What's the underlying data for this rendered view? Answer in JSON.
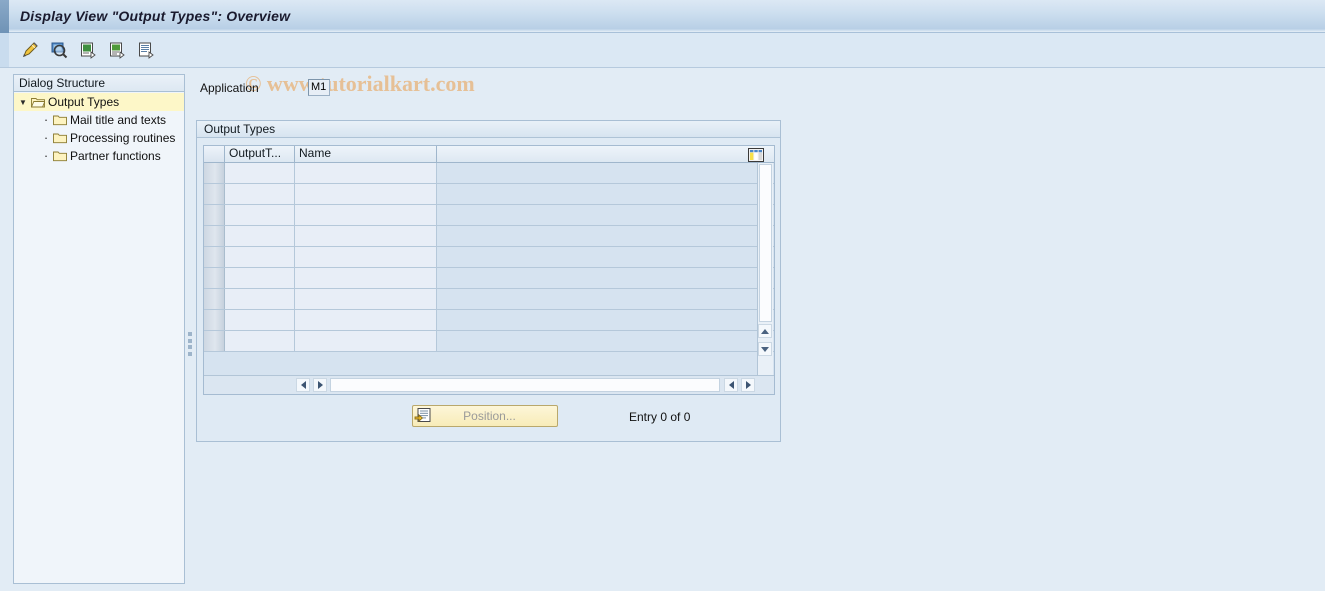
{
  "window": {
    "title": "Display View \"Output Types\": Overview"
  },
  "toolbar": {
    "buttons": [
      {
        "name": "display-change-icon",
        "title": "Display <-> Change"
      },
      {
        "name": "check-icon",
        "title": "Check"
      },
      {
        "name": "new-entries-icon",
        "title": "New Entries"
      },
      {
        "name": "copy-as-icon",
        "title": "Copy As..."
      },
      {
        "name": "details-icon",
        "title": "Details"
      }
    ]
  },
  "watermark": {
    "text": "© www.tutorialkart.com",
    "color": "#e7b986"
  },
  "sidebar": {
    "header": "Dialog Structure",
    "root": {
      "label": "Output Types",
      "selected": true
    },
    "items": [
      {
        "label": "Mail title and texts"
      },
      {
        "label": "Processing routines"
      },
      {
        "label": "Partner functions"
      }
    ]
  },
  "main": {
    "application": {
      "label": "Application",
      "value": "M1"
    },
    "group": {
      "title": "Output Types"
    },
    "table": {
      "columns": [
        {
          "key": "output_type",
          "label": "OutputT..."
        },
        {
          "key": "name",
          "label": "Name"
        }
      ],
      "rows": [
        {
          "output_type": "",
          "name": ""
        },
        {
          "output_type": "",
          "name": ""
        },
        {
          "output_type": "",
          "name": ""
        },
        {
          "output_type": "",
          "name": ""
        },
        {
          "output_type": "",
          "name": ""
        },
        {
          "output_type": "",
          "name": ""
        },
        {
          "output_type": "",
          "name": ""
        },
        {
          "output_type": "",
          "name": ""
        },
        {
          "output_type": "",
          "name": ""
        }
      ]
    },
    "footer": {
      "position_button_label": "Position...",
      "entry_status": "Entry 0 of 0"
    }
  }
}
